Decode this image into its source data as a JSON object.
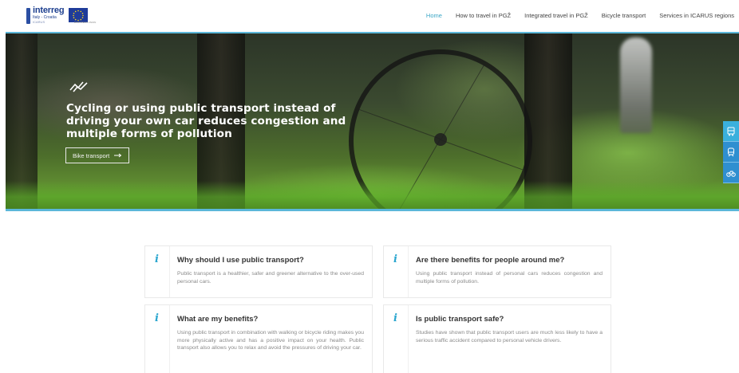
{
  "header": {
    "logo": {
      "title": "interreg",
      "subtitle": "Italy - Croatia",
      "project": "ICARUS",
      "eu_caption": "EUROPEAN UNION"
    },
    "nav": [
      {
        "label": "Home",
        "active": true
      },
      {
        "label": "How to travel in PGŽ",
        "active": false
      },
      {
        "label": "Integrated travel in PGŽ",
        "active": false
      },
      {
        "label": "Bicycle transport",
        "active": false
      },
      {
        "label": "Services in ICARUS regions",
        "active": false
      }
    ]
  },
  "hero": {
    "icon": "trend-line-icon",
    "title": "Cycling or using public transport instead of driving your own car reduces congestion and multiple forms of pollution",
    "button_label": "Bike transport",
    "button_icon": "arrow-right-icon",
    "side_tabs": [
      "bus-icon",
      "train-icon",
      "bicycle-icon"
    ]
  },
  "cards": [
    {
      "icon": "info-icon",
      "title": "Why should I use public transport?",
      "text": "Public transport is a healthier, safer and greener alternative to the over-used personal cars."
    },
    {
      "icon": "info-icon",
      "title": "Are there benefits for people around me?",
      "text": "Using public transport instead of personal cars reduces congestion and multiple forms of pollution."
    },
    {
      "icon": "info-icon",
      "title": "What are my benefits?",
      "text": "Using public transport in combination with walking or bicycle riding makes you more physically active and has a positive impact on your health. Public transport also allows you to relax and avoid the pressures of driving your car."
    },
    {
      "icon": "info-icon",
      "title": "Is public transport safe?",
      "text": "Studies have shown that public transport users are much less likely to have a serious traffic accident compared to personal vehicle drivers."
    }
  ],
  "colors": {
    "accent": "#3aa6c6",
    "side_tab": "#2f8fd0",
    "hero_border": "#5bb7d9"
  }
}
